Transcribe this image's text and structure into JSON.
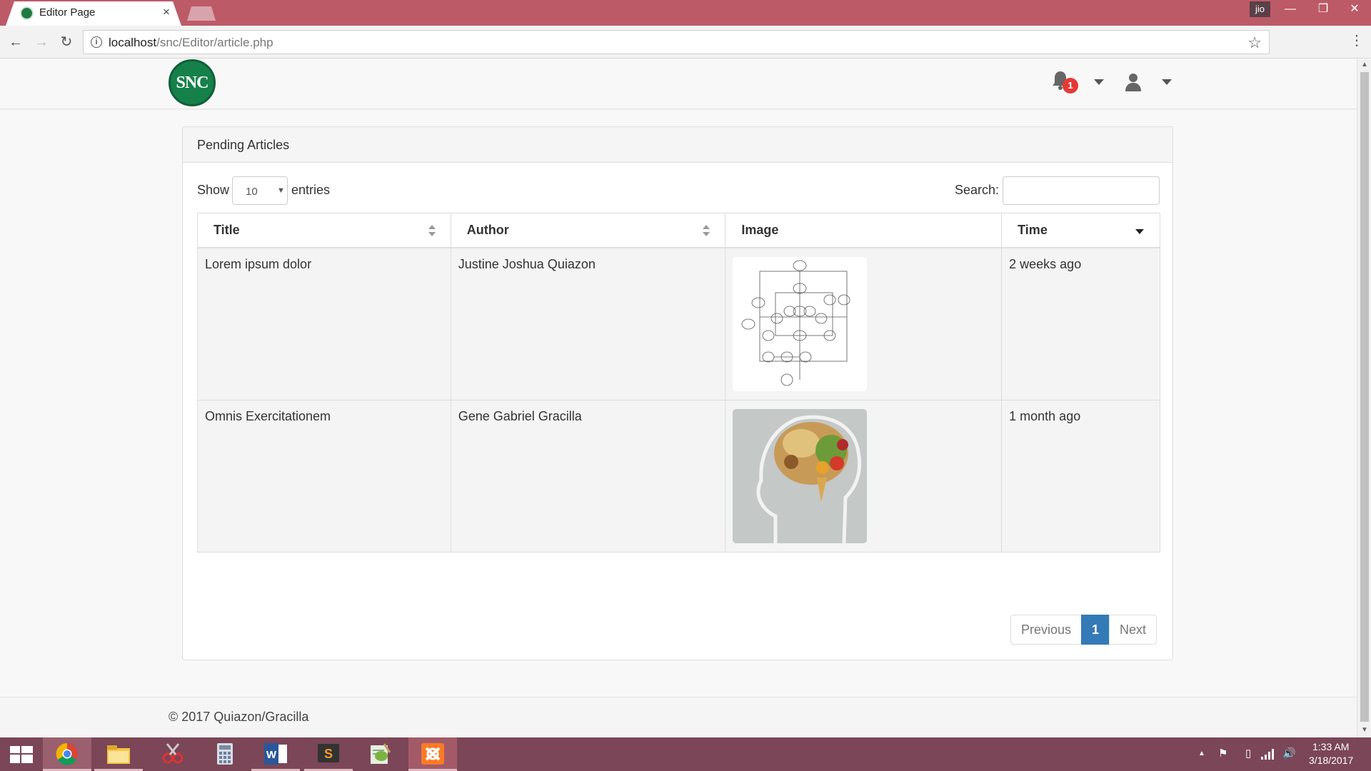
{
  "browser": {
    "tab_title": "Editor Page",
    "tab_close": "×",
    "profile_label": "jio",
    "url_host": "localhost",
    "url_path": "/snc/Editor/article.php"
  },
  "app": {
    "logo_text": "SNC",
    "notification_count": "1"
  },
  "panel": {
    "title": "Pending Articles",
    "show_label": "Show",
    "entries_label": "entries",
    "page_length": "10",
    "search_label": "Search:",
    "search_value": ""
  },
  "table": {
    "headers": [
      "Title",
      "Author",
      "Image",
      "Time"
    ],
    "rows": [
      {
        "title": "Lorem ipsum dolor",
        "author": "Justine Joshua Quiazon",
        "image": "flowchart-diagram-thumbnail",
        "time": "2 weeks ago"
      },
      {
        "title": "Omnis Exercitationem",
        "author": "Gene Gabriel Gracilla",
        "image": "brain-food-thumbnail",
        "time": "1 month ago"
      }
    ]
  },
  "pagination": {
    "previous": "Previous",
    "current": "1",
    "next": "Next"
  },
  "footer": {
    "copyright": "© 2017 Quiazon/Gracilla"
  },
  "taskbar": {
    "apps": [
      "windows-start",
      "chrome",
      "file-explorer",
      "snipping-tool",
      "calculator",
      "word",
      "sublime-text",
      "notepad-plus",
      "xampp"
    ],
    "time": "1:33 AM",
    "date": "3/18/2017"
  },
  "colors": {
    "titlebar": "#bd5a68",
    "taskbar": "#7b4657",
    "primary": "#337ab7",
    "badge": "#e53935",
    "logo": "#16804a"
  }
}
